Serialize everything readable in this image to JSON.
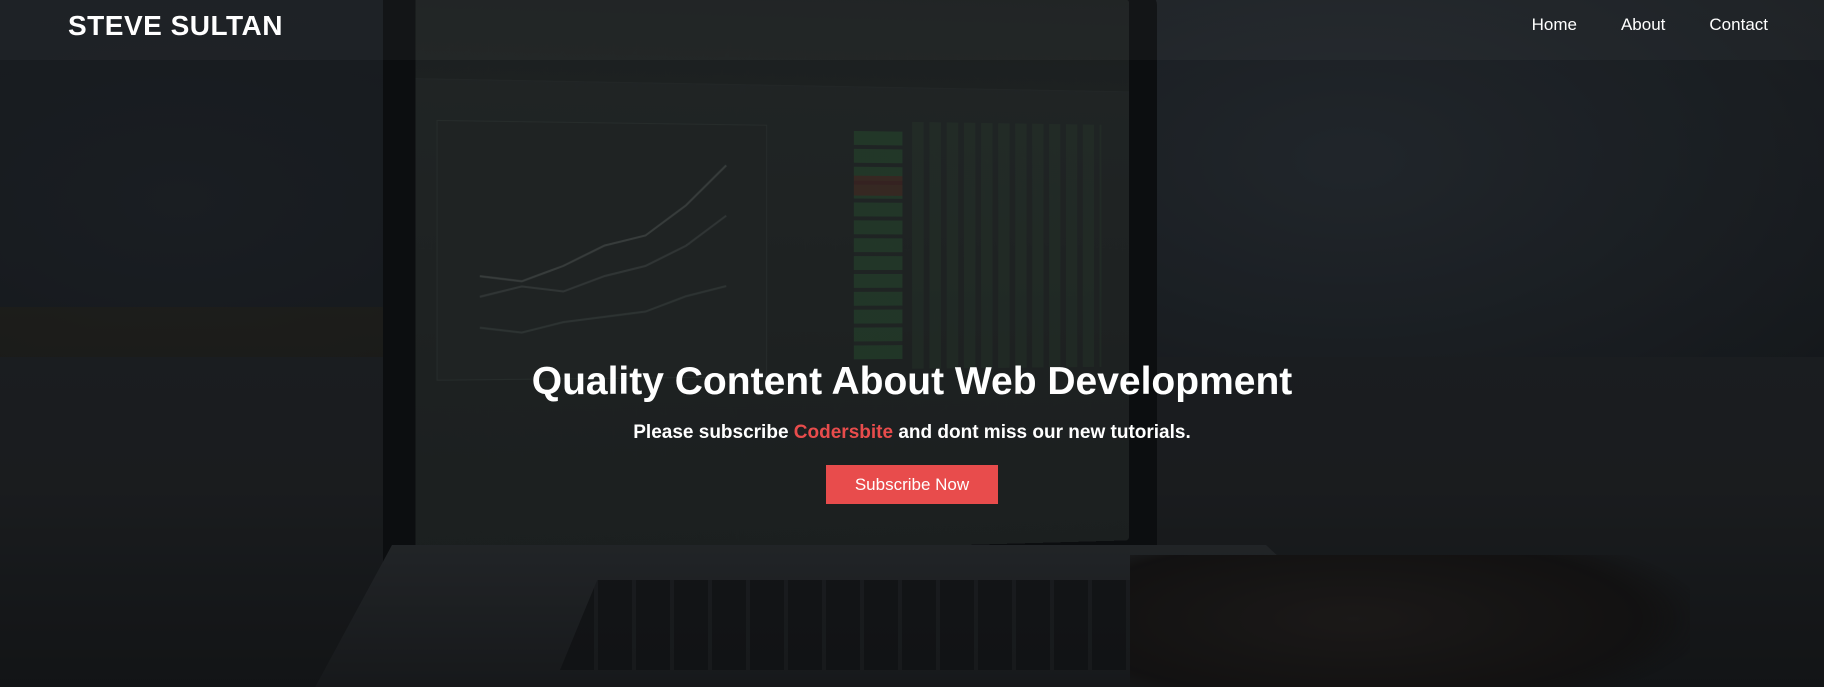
{
  "site": {
    "brand": "STEVE SULTAN"
  },
  "nav": {
    "items": [
      {
        "label": "Home"
      },
      {
        "label": "About"
      },
      {
        "label": "Contact"
      }
    ]
  },
  "hero": {
    "title": "Quality Content About Web Development",
    "subtitle_before": "Please subscribe ",
    "subtitle_highlight": "Codersbite",
    "subtitle_after": " and dont miss our new tutorials.",
    "button_label": "Subscribe Now",
    "background_image": "laptop-analytics-dashboard-photo"
  },
  "colors": {
    "accent": "#e84c4c",
    "text": "#ffffff",
    "overlay": "#0c0e11"
  }
}
